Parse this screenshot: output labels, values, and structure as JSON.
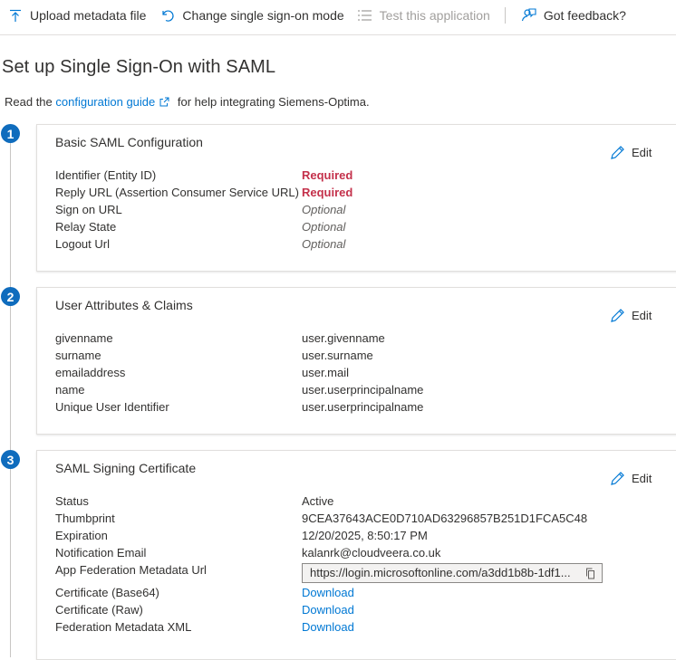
{
  "toolbar": {
    "upload_label": "Upload metadata file",
    "change_label": "Change single sign-on mode",
    "test_label": "Test this application",
    "feedback_label": "Got feedback?"
  },
  "page": {
    "title": "Set up Single Sign-On with SAML",
    "intro_before": "Read the",
    "intro_link": "configuration guide",
    "intro_after": "for help integrating Siemens-Optima."
  },
  "sections": [
    {
      "step": "1",
      "title": "Basic SAML Configuration",
      "edit_label": "Edit",
      "rows": [
        {
          "label": "Identifier (Entity ID)",
          "value": "Required"
        },
        {
          "label": "Reply URL (Assertion Consumer Service URL)",
          "value": "Required"
        },
        {
          "label": "Sign on URL",
          "value": "Optional"
        },
        {
          "label": "Relay State",
          "value": "Optional"
        },
        {
          "label": "Logout Url",
          "value": "Optional"
        }
      ]
    },
    {
      "step": "2",
      "title": "User Attributes & Claims",
      "edit_label": "Edit",
      "rows": [
        {
          "label": "givenname",
          "value": "user.givenname"
        },
        {
          "label": "surname",
          "value": "user.surname"
        },
        {
          "label": "emailaddress",
          "value": "user.mail"
        },
        {
          "label": "name",
          "value": "user.userprincipalname"
        },
        {
          "label": "Unique User Identifier",
          "value": "user.userprincipalname"
        }
      ]
    },
    {
      "step": "3",
      "title": "SAML Signing Certificate",
      "edit_label": "Edit",
      "rows": [
        {
          "label": "Status",
          "value": "Active"
        },
        {
          "label": "Thumbprint",
          "value": "9CEA37643ACE0D710AD63296857B251D1FCA5C48"
        },
        {
          "label": "Expiration",
          "value": "12/20/2025, 8:50:17 PM"
        },
        {
          "label": "Notification Email",
          "value": "kalanrk@cloudveera.co.uk"
        },
        {
          "label": "App Federation Metadata Url",
          "value": "https://login.microsoftonline.com/a3dd1b8b-1df1..."
        },
        {
          "label": "Certificate (Base64)",
          "value": "Download"
        },
        {
          "label": "Certificate (Raw)",
          "value": "Download"
        },
        {
          "label": "Federation Metadata XML",
          "value": "Download"
        }
      ]
    }
  ],
  "colors": {
    "accent": "#0078d4",
    "step_badge": "#0f6cbd",
    "required": "#c4314b"
  }
}
